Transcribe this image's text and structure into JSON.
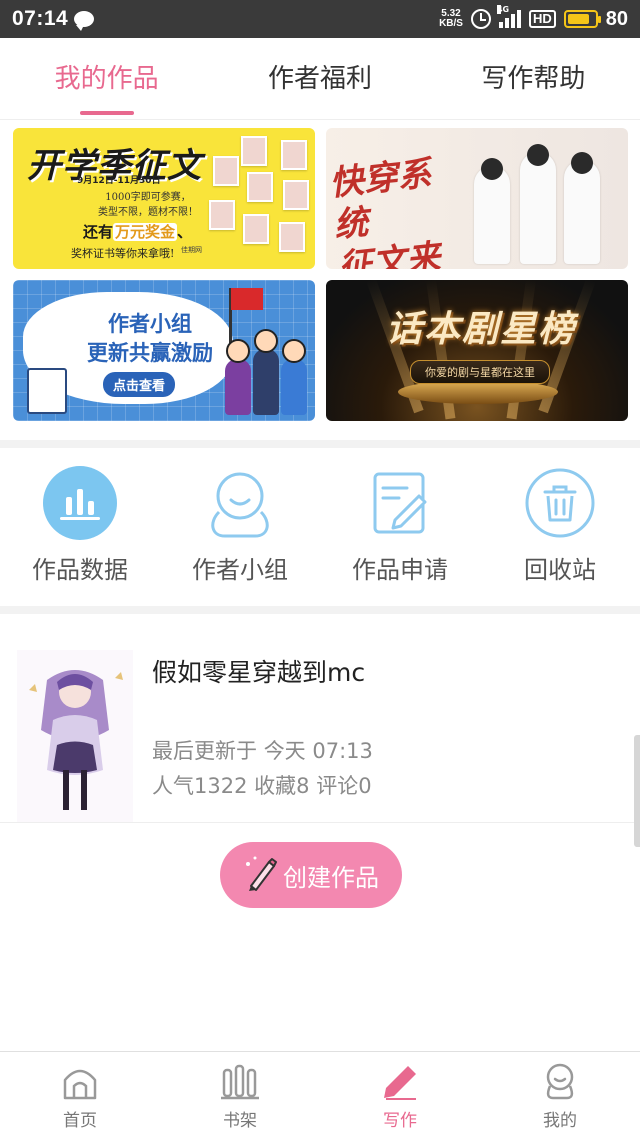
{
  "status_bar": {
    "time": "07:14",
    "net_speed_value": "5.32",
    "net_speed_unit": "KB/S",
    "signal_type": "4G",
    "hd": "HD",
    "battery_level": "80"
  },
  "tabs": [
    {
      "label": "我的作品",
      "active": true
    },
    {
      "label": "作者福利",
      "active": false
    },
    {
      "label": "写作帮助",
      "active": false
    }
  ],
  "banners": {
    "banner1": {
      "title": "开学季征文",
      "date": "9月12日-11月30日",
      "line1": "1000字即可参赛，",
      "line2": "类型不限，题材不限！",
      "prize_prefix": "还有",
      "prize_highlight": "万元奖金",
      "prize_suffix": "、",
      "trophy": "奖杯证书等你来拿哦!",
      "brand": "佳期网"
    },
    "banner2": {
      "title_line1": "快穿系统",
      "title_line2": "征文来了"
    },
    "banner3": {
      "title_line1": "作者小组",
      "title_line2": "更新共赢激励",
      "button": "点击查看"
    },
    "banner4": {
      "title": "话本剧星榜",
      "subtitle": "你爱的剧与星都在这里"
    }
  },
  "actions": [
    {
      "label": "作品数据",
      "icon": "bar-chart-icon"
    },
    {
      "label": "作者小组",
      "icon": "person-icon"
    },
    {
      "label": "作品申请",
      "icon": "edit-document-icon"
    },
    {
      "label": "回收站",
      "icon": "trash-icon"
    }
  ],
  "work": {
    "title": "假如零星穿越到mc",
    "updated_label": "最后更新于",
    "updated_time": "今天 07:13",
    "popularity": "人气1322",
    "favorites": "收藏8",
    "comments": "评论0"
  },
  "create_button": {
    "label": "创建作品"
  },
  "bottom_nav": [
    {
      "label": "首页",
      "icon": "home-icon",
      "active": false
    },
    {
      "label": "书架",
      "icon": "bookshelf-icon",
      "active": false
    },
    {
      "label": "写作",
      "icon": "pencil-icon",
      "active": true
    },
    {
      "label": "我的",
      "icon": "profile-icon",
      "active": false
    }
  ],
  "colors": {
    "accent": "#e8698f",
    "create_button": "#f388b0",
    "action_icon": "#6ec0ee"
  }
}
